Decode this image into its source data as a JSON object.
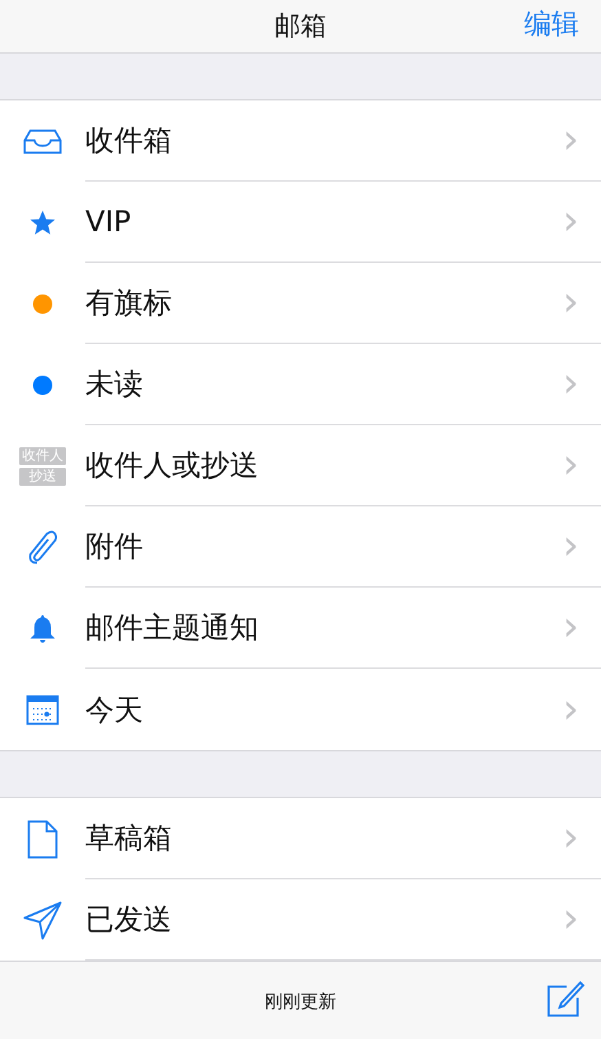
{
  "nav": {
    "title": "邮箱",
    "edit": "编辑"
  },
  "sections": [
    {
      "items": [
        {
          "kind": "inbox",
          "label": "收件箱",
          "chevron": "›"
        },
        {
          "kind": "star",
          "label": "VIP",
          "chevron": "›"
        },
        {
          "kind": "dot",
          "color": "#ff9500",
          "label": "有旗标",
          "chevron": "›"
        },
        {
          "kind": "dot",
          "color": "#007aff",
          "label": "未读",
          "chevron": "›"
        },
        {
          "kind": "tocc",
          "badges": [
            "收件人",
            "抄送"
          ],
          "label": "收件人或抄送",
          "chevron": "›"
        },
        {
          "kind": "attachment",
          "label": "附件",
          "chevron": "›"
        },
        {
          "kind": "bell",
          "label": "邮件主题通知",
          "chevron": "›"
        },
        {
          "kind": "calendar",
          "label": "今天",
          "chevron": "›"
        }
      ]
    },
    {
      "items": [
        {
          "kind": "draft",
          "label": "草稿箱",
          "chevron": "›"
        },
        {
          "kind": "sent",
          "label": "已发送",
          "chevron": "›"
        }
      ]
    }
  ],
  "toolbar": {
    "status": "刚刚更新"
  }
}
